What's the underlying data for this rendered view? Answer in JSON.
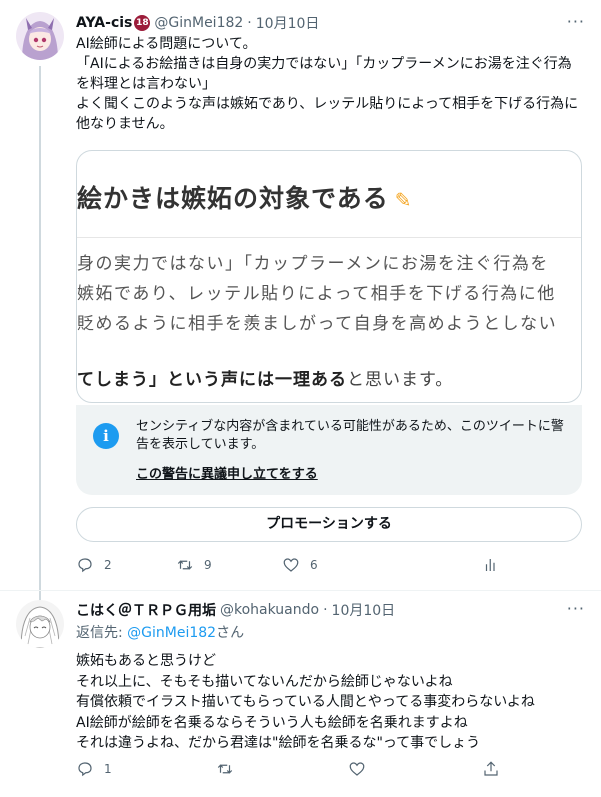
{
  "tweet1": {
    "author_name": "AYA-cis",
    "author_badge": "18",
    "handle": "@GinMei182",
    "separator": "·",
    "date": "10月10日",
    "text": "AI絵師による問題について。\n「AIによるお絵描きは自身の実力ではない」「カップラーメンにお湯を注ぐ行為を料理とは言わない」\nよく聞くこのような声は嫉妬であり、レッテル貼りによって相手を下げる行為に他なりません。",
    "card": {
      "title": "絵かきは嫉妬の対象である",
      "line1": "身の実力ではない」「カップラーメンにお湯を注ぐ行為を",
      "line2": "嫉妬であり、レッテル貼りによって相手を下げる行為に他",
      "line3": "貶めるように相手を羨ましがって自身を高めようとしない",
      "last_bold": "てしまう」という声には一理ある",
      "last_rest": "と思います。"
    },
    "warning": {
      "icon": "i",
      "text": "センシティブな内容が含まれている可能性があるため、このツイートに警告を表示しています。",
      "link": "この警告に異議申し立てをする"
    },
    "promote_label": "プロモーションする",
    "reply_count": "2",
    "retweet_count": "9",
    "like_count": "6"
  },
  "tweet2": {
    "author_name": "こはく＠ＴＲＰＧ用垢",
    "handle": "@kohakuando",
    "separator": "·",
    "date": "10月10日",
    "replying_prefix": "返信先: ",
    "replying_handle": "@GinMei182",
    "replying_suffix": "さん",
    "text": "嫉妬もあると思うけど\nそれ以上に、そもそも描いてないんだから絵師じゃないよね\n有償依頼でイラスト描いてもらっている人間とやってる事変わらないよね\nAI絵師が絵師を名乗るならそういう人も絵師を名乗れますよね\nそれは違うよね、だから君達は\"絵師を名乗るな\"って事でしょう",
    "reply_count": "1"
  },
  "icons": [
    "more-icon",
    "info-icon",
    "reply-icon",
    "retweet-icon",
    "like-icon",
    "stats-icon",
    "share-icon",
    "pencil-icon"
  ],
  "colors": {
    "accent": "#1d9bf0",
    "muted": "#536471",
    "border": "#cfd9de",
    "warning_bg": "#eff3f4",
    "badge": "#9c1c3a"
  }
}
